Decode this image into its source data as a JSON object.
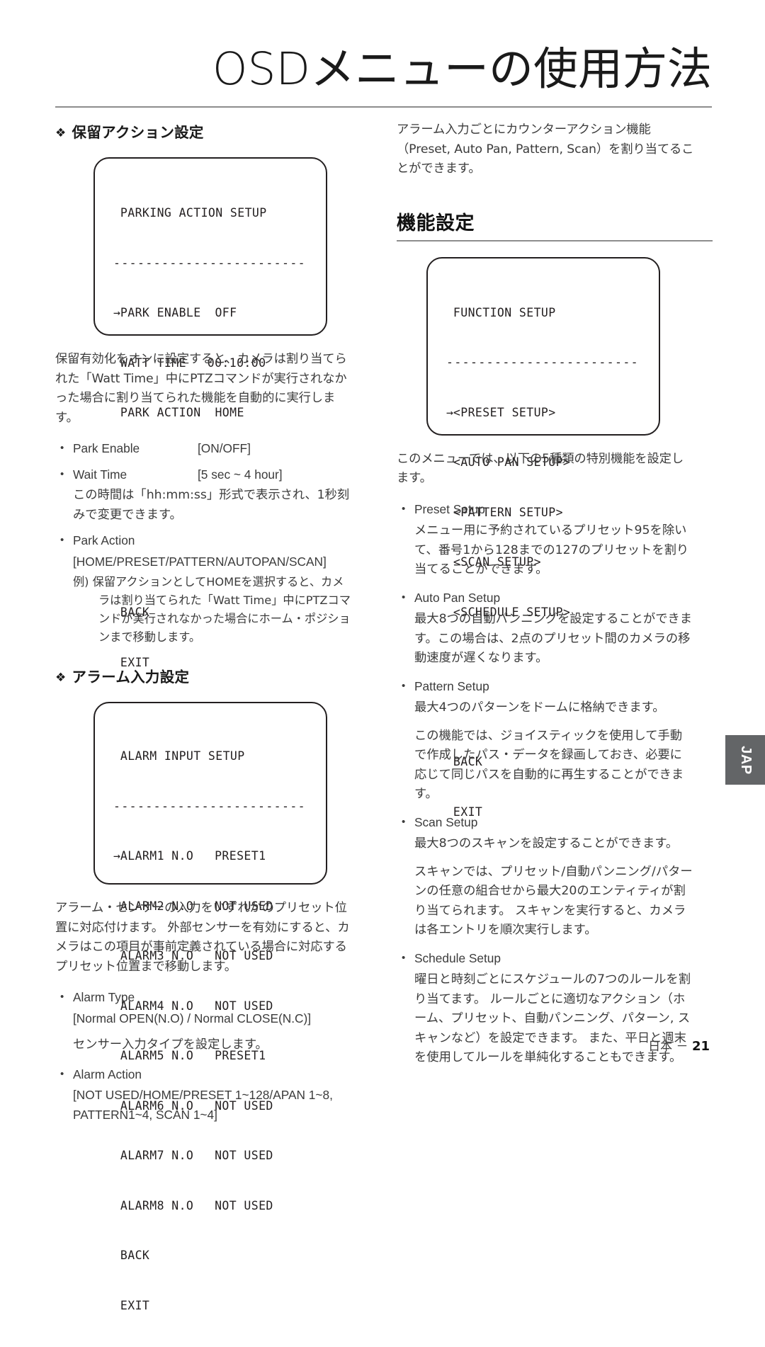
{
  "page": {
    "title": "OSDメニューの使用方法",
    "footer_locale": "日本 －",
    "footer_page": "21",
    "side_tab": "JAP"
  },
  "left_column": {
    "section1": {
      "bullet_glyph": "❖",
      "heading": "保留アクション設定",
      "osd": {
        "title": "PARKING ACTION SETUP",
        "divider": "------------------------",
        "rows": [
          {
            "arrow": "→",
            "label": "PARK ENABLE",
            "value": "OFF"
          },
          {
            "arrow": " ",
            "label": "WATT TIME",
            "value": "00:10:00"
          },
          {
            "arrow": " ",
            "label": "PARK ACTION",
            "value": "HOME"
          }
        ],
        "footer_items": [
          "BACK",
          "EXIT"
        ]
      },
      "paragraph": "保留有効化をオンに設定すると、カメラは割り当てられた「Watt Time」中にPTZコマンドが実行されなかった場合に割り当てられた機能を自動的に実行します。",
      "items": [
        {
          "label": "Park Enable",
          "value": "[ON/OFF]",
          "notes": []
        },
        {
          "label": "Wait Time",
          "value": "[5 sec ~ 4 hour]",
          "notes": [
            "この時間は「hh:mm:ss」形式で表示され、1秒刻みで変更できます。"
          ]
        },
        {
          "label": "Park Action",
          "value": "",
          "notes": [
            "[HOME/PRESET/PATTERN/AUTOPAN/SCAN]"
          ],
          "example_marker": "例)",
          "example": "保留アクションとしてHOMEを選択すると、カメラは割り当てられた「Watt Time」中にPTZコマンドが実行されなかった場合にホーム・ポジションまで移動します。"
        }
      ]
    },
    "section2": {
      "bullet_glyph": "❖",
      "heading": "アラーム入力設定",
      "osd": {
        "title": "ALARM INPUT SETUP",
        "divider": "------------------------",
        "rows": [
          {
            "arrow": "→",
            "label": "ALARM1 N.O",
            "value": "PRESET1"
          },
          {
            "arrow": " ",
            "label": "ALARM2 N.O",
            "value": "NOT USED"
          },
          {
            "arrow": " ",
            "label": "ALARM3 N.O",
            "value": "NOT USED"
          },
          {
            "arrow": " ",
            "label": "ALARM4 N.O",
            "value": "NOT USED"
          },
          {
            "arrow": " ",
            "label": "ALARM5 N.O",
            "value": "PRESET1"
          },
          {
            "arrow": " ",
            "label": "ALARM6 N.O",
            "value": "NOT USED"
          },
          {
            "arrow": " ",
            "label": "ALARM7 N.O",
            "value": "NOT USED"
          },
          {
            "arrow": " ",
            "label": "ALARM8 N.O",
            "value": "NOT USED"
          }
        ],
        "footer_items": [
          "BACK",
          "EXIT"
        ]
      },
      "paragraph": "アラーム・センサーの入力をいずれかのプリセット位置に対応付けます。 外部センサーを有効にすると、カメラはこの項目が事前定義されている場合に対応するプリセット位置まで移動します。",
      "items": [
        {
          "label": "Alarm Type",
          "value": "",
          "notes": [
            "[Normal OPEN(N.O) / Normal CLOSE(N.C)]",
            "センサー入力タイプを設定します。"
          ]
        },
        {
          "label": "Alarm Action",
          "value": "",
          "notes": [
            "[NOT USED/HOME/PRESET 1~128/APAN 1~8, PATTERN1~4, SCAN 1~4]"
          ]
        }
      ]
    }
  },
  "right_column": {
    "intro": "アラーム入力ごとにカウンターアクション機能（Preset, Auto Pan, Pattern, Scan）を割り当てることができます。",
    "section": {
      "heading": "機能設定",
      "osd": {
        "title": "FUNCTION SETUP",
        "divider": "------------------------",
        "rows": [
          {
            "arrow": "→",
            "label": "<PRESET SETUP>"
          },
          {
            "arrow": " ",
            "label": "<AUTO PAN SETUP>"
          },
          {
            "arrow": " ",
            "label": "<PATTERN SETUP>"
          },
          {
            "arrow": " ",
            "label": "<SCAN SETUP>"
          },
          {
            "arrow": " ",
            "label": "<SCHEDULE SETUP>"
          }
        ],
        "footer_items": [
          "BACK",
          "EXIT"
        ]
      },
      "paragraph": "このメニューでは、以下の5種類の特別機能を設定します。",
      "items": [
        {
          "label": "Preset Setup",
          "notes": [
            "メニュー用に予約されているプリセット95を除いて、番号1から128までの127のプリセットを割り当てることができます。"
          ]
        },
        {
          "label": "Auto Pan Setup",
          "notes": [
            "最大8つの自動パンニングを設定することができます。この場合は、2点のプリセット間のカメラの移動速度が遅くなります。"
          ]
        },
        {
          "label": "Pattern Setup",
          "notes": [
            "最大4つのパターンをドームに格納できます。",
            "この機能では、ジョイスティックを使用して手動で作成したパス・データを録画しておき、必要に応じて同じパスを自動的に再生することができます。"
          ]
        },
        {
          "label": "Scan Setup",
          "notes": [
            "最大8つのスキャンを設定することができます。",
            "スキャンでは、プリセット/自動パンニング/パターンの任意の組合せから最大20のエンティティが割り当てられます。 スキャンを実行すると、カメラは各エントリを順次実行します。"
          ]
        },
        {
          "label": "Schedule Setup",
          "notes": [
            "曜日と時刻ごとにスケジュールの7つのルールを割り当てます。 ルールごとに適切なアクション（ホーム、プリセット、自動パンニング、パターン, スキャンなど）を設定できます。 また、平日と週末を使用してルールを単純化することもできます。"
          ]
        }
      ]
    }
  }
}
